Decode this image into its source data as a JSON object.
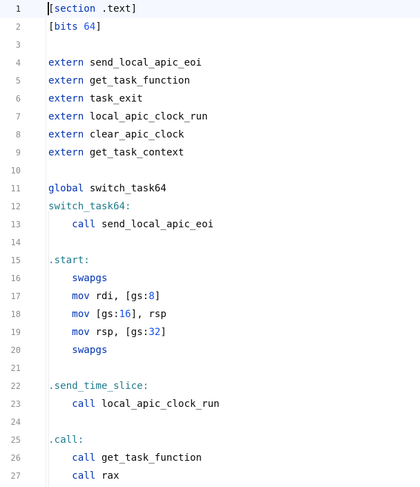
{
  "editor": {
    "current_line": 1,
    "lines": [
      {
        "n": "1",
        "tokens": [
          {
            "t": "[",
            "c": "plain"
          },
          {
            "t": "section",
            "c": "kw"
          },
          {
            "t": " .text]",
            "c": "plain"
          }
        ]
      },
      {
        "n": "2",
        "tokens": [
          {
            "t": "[",
            "c": "plain"
          },
          {
            "t": "bits",
            "c": "kw"
          },
          {
            "t": " ",
            "c": "plain"
          },
          {
            "t": "64",
            "c": "num"
          },
          {
            "t": "]",
            "c": "plain"
          }
        ]
      },
      {
        "n": "3",
        "tokens": []
      },
      {
        "n": "4",
        "tokens": [
          {
            "t": "extern",
            "c": "kw"
          },
          {
            "t": " send_local_apic_eoi",
            "c": "plain"
          }
        ]
      },
      {
        "n": "5",
        "tokens": [
          {
            "t": "extern",
            "c": "kw"
          },
          {
            "t": " get_task_function",
            "c": "plain"
          }
        ]
      },
      {
        "n": "6",
        "tokens": [
          {
            "t": "extern",
            "c": "kw"
          },
          {
            "t": " task_exit",
            "c": "plain"
          }
        ]
      },
      {
        "n": "7",
        "tokens": [
          {
            "t": "extern",
            "c": "kw"
          },
          {
            "t": " local_apic_clock_run",
            "c": "plain"
          }
        ]
      },
      {
        "n": "8",
        "tokens": [
          {
            "t": "extern",
            "c": "kw"
          },
          {
            "t": " clear_apic_clock",
            "c": "plain"
          }
        ]
      },
      {
        "n": "9",
        "tokens": [
          {
            "t": "extern",
            "c": "kw"
          },
          {
            "t": " get_task_context",
            "c": "plain"
          }
        ]
      },
      {
        "n": "10",
        "tokens": []
      },
      {
        "n": "11",
        "tokens": [
          {
            "t": "global",
            "c": "kw"
          },
          {
            "t": " switch_task64",
            "c": "plain"
          }
        ]
      },
      {
        "n": "12",
        "tokens": [
          {
            "t": "switch_task64:",
            "c": "lbl"
          }
        ]
      },
      {
        "n": "13",
        "tokens": [
          {
            "t": "    ",
            "c": "plain"
          },
          {
            "t": "call",
            "c": "kw"
          },
          {
            "t": " send_local_apic_eoi",
            "c": "plain"
          }
        ]
      },
      {
        "n": "14",
        "tokens": []
      },
      {
        "n": "15",
        "tokens": [
          {
            "t": ".start:",
            "c": "lbl"
          }
        ]
      },
      {
        "n": "16",
        "tokens": [
          {
            "t": "    ",
            "c": "plain"
          },
          {
            "t": "swapgs",
            "c": "kw"
          }
        ]
      },
      {
        "n": "17",
        "tokens": [
          {
            "t": "    ",
            "c": "plain"
          },
          {
            "t": "mov",
            "c": "kw"
          },
          {
            "t": " rdi, [gs:",
            "c": "plain"
          },
          {
            "t": "8",
            "c": "num"
          },
          {
            "t": "]",
            "c": "plain"
          }
        ]
      },
      {
        "n": "18",
        "tokens": [
          {
            "t": "    ",
            "c": "plain"
          },
          {
            "t": "mov",
            "c": "kw"
          },
          {
            "t": " [gs:",
            "c": "plain"
          },
          {
            "t": "16",
            "c": "num"
          },
          {
            "t": "], rsp",
            "c": "plain"
          }
        ]
      },
      {
        "n": "19",
        "tokens": [
          {
            "t": "    ",
            "c": "plain"
          },
          {
            "t": "mov",
            "c": "kw"
          },
          {
            "t": " rsp, [gs:",
            "c": "plain"
          },
          {
            "t": "32",
            "c": "num"
          },
          {
            "t": "]",
            "c": "plain"
          }
        ]
      },
      {
        "n": "20",
        "tokens": [
          {
            "t": "    ",
            "c": "plain"
          },
          {
            "t": "swapgs",
            "c": "kw"
          }
        ]
      },
      {
        "n": "21",
        "tokens": []
      },
      {
        "n": "22",
        "tokens": [
          {
            "t": ".send_time_slice:",
            "c": "lbl"
          }
        ]
      },
      {
        "n": "23",
        "tokens": [
          {
            "t": "    ",
            "c": "plain"
          },
          {
            "t": "call",
            "c": "kw"
          },
          {
            "t": " local_apic_clock_run",
            "c": "plain"
          }
        ]
      },
      {
        "n": "24",
        "tokens": []
      },
      {
        "n": "25",
        "tokens": [
          {
            "t": ".call:",
            "c": "lbl"
          }
        ]
      },
      {
        "n": "26",
        "tokens": [
          {
            "t": "    ",
            "c": "plain"
          },
          {
            "t": "call",
            "c": "kw"
          },
          {
            "t": " get_task_function",
            "c": "plain"
          }
        ]
      },
      {
        "n": "27",
        "tokens": [
          {
            "t": "    ",
            "c": "plain"
          },
          {
            "t": "call",
            "c": "kw"
          },
          {
            "t": " rax",
            "c": "plain"
          }
        ]
      }
    ]
  },
  "colors": {
    "keyword": "#0033b3",
    "label": "#1f7a8c",
    "number": "#1750eb",
    "text": "#080808",
    "line_number": "#8c8c8c",
    "current_line_bg": "#f5f8fe"
  }
}
